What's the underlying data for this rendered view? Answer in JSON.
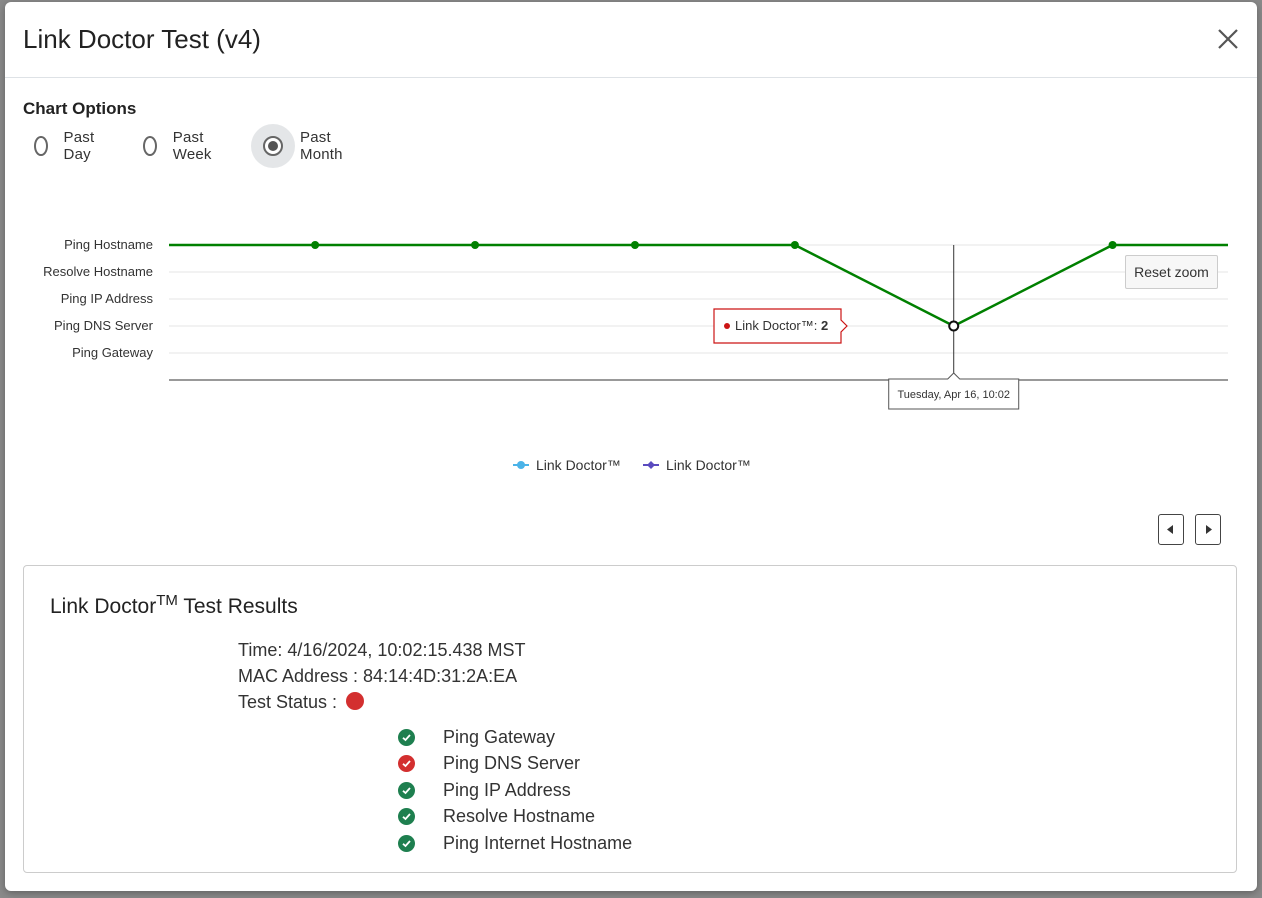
{
  "modal": {
    "title": "Link Doctor Test (v4)",
    "close_icon": "close-icon"
  },
  "chart_options": {
    "title": "Chart Options",
    "options": [
      {
        "label": "Past Day",
        "checked": false
      },
      {
        "label": "Past Week",
        "checked": false
      },
      {
        "label": "Past Month",
        "checked": true
      }
    ]
  },
  "chart_data": {
    "type": "line",
    "y_categories": [
      "Ping Gateway",
      "Ping DNS Server",
      "Ping IP Address",
      "Resolve Hostname",
      "Ping Hostname"
    ],
    "series": [
      {
        "name": "Link Doctor™",
        "color": "#008000",
        "points": [
          {
            "x": 0.0,
            "y": 4
          },
          {
            "x": 0.138,
            "y": 4
          },
          {
            "x": 0.289,
            "y": 4
          },
          {
            "x": 0.44,
            "y": 4
          },
          {
            "x": 0.591,
            "y": 4
          },
          {
            "x": 0.741,
            "y": 1
          },
          {
            "x": 0.891,
            "y": 4
          },
          {
            "x": 1.0,
            "y": 4
          }
        ]
      }
    ],
    "legend": [
      {
        "name": "Link Doctor™",
        "color": "#4bb3e8"
      },
      {
        "name": "Link Doctor™",
        "color": "#5a4bbf"
      }
    ],
    "tooltip": {
      "series": "Link Doctor™: ",
      "value": "2"
    },
    "crosshair_label": "Tuesday, Apr 16, 10:02",
    "reset_zoom_label": "Reset zoom"
  },
  "results": {
    "title_main": "Link Doctor",
    "title_sup": "TM",
    "title_rest": " Test Results",
    "time": "Time: 4/16/2024, 10:02:15.438 MST",
    "mac": "MAC Address : 84:14:4D:31:2A:EA",
    "status_label": "Test Status :",
    "status_color": "#d32f2f",
    "checks": [
      {
        "label": "Ping Gateway",
        "status": "pass"
      },
      {
        "label": "Ping DNS Server",
        "status": "fail"
      },
      {
        "label": "Ping IP Address",
        "status": "pass"
      },
      {
        "label": "Resolve Hostname",
        "status": "pass"
      },
      {
        "label": "Ping Internet Hostname",
        "status": "pass"
      }
    ]
  },
  "colors": {
    "pass": "#1e7f4f",
    "fail": "#d32f2f"
  }
}
